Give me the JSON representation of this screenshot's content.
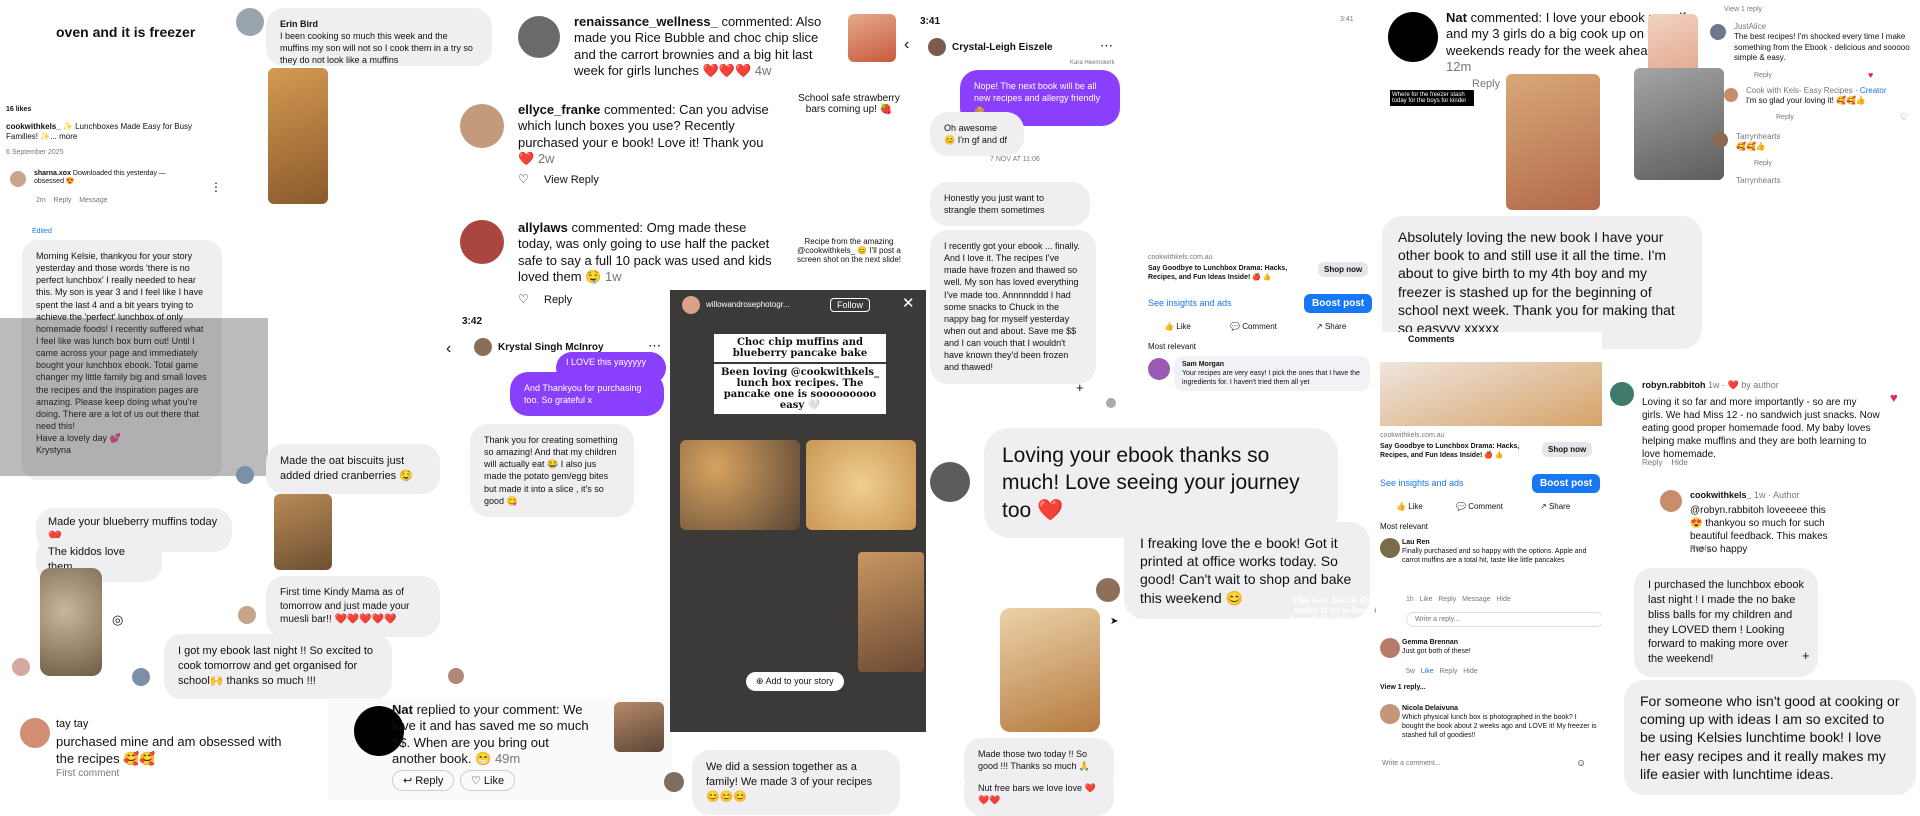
{
  "col1": {
    "overlay_text": "oven and it is freezer",
    "likes": "16 likes",
    "caption_user": "cookwithkels_",
    "caption_text": "✨ Lunchboxes Made Easy for Busy Families! ✨... more",
    "date": "6 September 2025",
    "sharna_user": "sharna.xox",
    "sharna_text": "Downloaded this yesterday — obsessed 😍",
    "sharna_meta": [
      "2m",
      "Reply",
      "Message"
    ],
    "edited": "Edited",
    "krystyna_msg": "Morning Kelsie, thankyou for your story yesterday and those words 'there is no perfect lunchbox' I really needed to hear this. My son is year 3 and I feel like I have spent the last 4 and a bit years trying to achieve the 'perfect' lunchbox of only homemade foods! I recently suffered what I feel like was lunch box burn out! Until I came across your page and immediately bought your lunchbox ebook. Total game changer my little family big and small loves the recipes and the inspiration pages are amazing. Please keep doing what you're doing. There are a lot of us out there that need this!",
    "krystyna_sign": "Have a lovely day 💕",
    "krystyna_name": "Krystyna",
    "blueberry_msg": "Made your blueberry muffins today ❤️",
    "kiddos_msg": "The kiddos love them.",
    "taytay_name": "tay tay",
    "taytay_msg": "purchased mine and am obsessed with the recipes 🥰🥰",
    "taytay_sub": "First comment"
  },
  "col2": {
    "erin_name": "Erin Bird",
    "erin_msg": "I been cooking so much this week and the muffins my son will not so I cook them in a try so they do not look like a muffins",
    "oat_msg": "Made the oat biscuits just added dried cranberries 🤤",
    "kindy_msg": "First time Kindy Mama as of tomorrow and just made your muesli bar!! ❤️❤️❤️❤️❤️",
    "ebook_msg": "I got my ebook last night !! So excited to cook tomorrow and get organised for school🙌 thanks so much !!!"
  },
  "col3": {
    "c1_user": "renaissance_wellness_",
    "c1_text": "commented: Also made you Rice Bubble and choc chip slice and the carrort brownies and a big hit last week for girls lunches ❤️❤️❤️",
    "c1_time": "4w",
    "c2_user": "ellyce_franke",
    "c2_text": "commented: Can you advise which lunch boxes you use? Recently purchased your e book! Love it! Thank you ❤️",
    "c2_time": "2w",
    "view_reply": "View Reply",
    "c3_user": "allylaws",
    "c3_text": "commented: Omg made these today, was only going to use half the packet safe to say a full 10 pack was used and kids loved them 🤤",
    "c3_time": "1w",
    "reply": "Reply",
    "time": "3:42",
    "chat_name": "Krystal Singh McInroy",
    "chat_top": "I LOVE this yayyyyy xxx",
    "chat_thanks": "And Thankyou for purchasing too. So grateful x",
    "chat_msg": "Thank you for creating something so amazing! And that my children will actually eat 😂 I also jus made the potato gem/egg bites but made it into a slice , it's so good 😋",
    "nat_name": "Nat",
    "nat_msg": "replied to your comment: We love it and has saved me so much $$. When are you bring out another book. 😁",
    "nat_time": "49m",
    "like": "Like"
  },
  "col4": {
    "story_top": "School safe strawberry bars coming up! 🍓",
    "story_bottom": "Recipe from the amazing @cookwithkels_ 😊 I'll post a screen shot on the next slide!",
    "choc_title": "Choc chip muffins and blueberry pancake bake",
    "choc_body": "Been loving @cookwithkels_ lunch box recipes. The pancake one is sooooooooo easy 🤍",
    "add_story": "Add to your story",
    "story_user": "willowandrosephotogr...",
    "follow": "Follow",
    "session_msg": "We did a session together as a family! We made 3 of your recipes 😊😊😊"
  },
  "col5": {
    "time": "3:41",
    "name": "Crystal-Leigh Eiszele",
    "sender_label": "Kara Heemskerk",
    "purple_msg": "Nope! The next book will be all new recipes and allergy friendly 🙈",
    "awesome_msg": "Oh awesome 😊 I'm gf and df",
    "date_sep": "7 NOV AT 11:06",
    "honest_msg": "Honestly you just want to strangle them sometimes",
    "ebook_msg": "I recently got your ebook ... finally. And I love it. The recipes I've made have frozen and thawed so well. My son has loved everything I've made too. Annnnnddd I had some snacks to Chuck in the nappy bag for myself yesterday when out and about. Save me $$ and I can vouch that I wouldn't have known they'd been frozen and thawed!",
    "loving_msg": "Loving your ebook thanks so much! Love seeing your journey too ❤️",
    "freaking_msg": "I freaking love the e book! Got it printed at office works today. So good! Can't wait to shop and bake this weekend 😊",
    "two_today": "Made those two today !! So good !!! Thanks so much 🙏🙏🙏",
    "nutfree": "Nut free bars we love love ❤️❤️❤️"
  },
  "col6": {
    "domain": "cookwithkels.com.au",
    "ad_title": "Say Goodbye to Lunchbox Drama: Hacks, Recipes, and Fun Ideas Inside! 🍎 👍",
    "shop_now": "Shop now",
    "insights": "See insights and ads",
    "boost": "Boost post",
    "like": "Like",
    "comment": "Comment",
    "share": "Share",
    "most_relevant": "Most relevant",
    "sam_name": "Sam Morgan",
    "sam_text": "Your recipes are very easy! I pick the ones that I have the ingredients for. I haven't tried them all yet",
    "last_batch": "The last batch didn't make it to school 😂 hopefully this will get a few days before I need to make more. Thank goodness they are quick and easy",
    "status_time": "3:41"
  },
  "col7": {
    "nat_name": "Nat",
    "nat_text": "commented: I love your ebook myself and my 3 girls do a big cook up on the weekends ready for the week ahead xx",
    "nat_time": "12m",
    "reply": "Reply",
    "absolutely_msg": "Absolutely loving the new book I have your other book to and still use it all the time. I'm about to give birth to my 4th boy and my freezer is stashed up for the beginning of school next week. Thank you for making that so easyyy xxxxx",
    "comments_hdr": "Comments",
    "domain": "cookwithkels.com.au",
    "ad_title": "Say Goodbye to Lunchbox Drama: Hacks, Recipes, and Fun Ideas Inside! 🍎 👍",
    "shop_now": "Shop now",
    "insights": "See insights and ads",
    "boost": "Boost post",
    "like": "Like",
    "comment": "Comment",
    "share": "Share",
    "most_relevant": "Most relevant",
    "lau_name": "Lau Ren",
    "lau_text": "Finally purchased and so happy with the options. Apple and carrot muffins are a total hit, taste like little pancakes",
    "lau_meta": [
      "1h",
      "Like",
      "Reply",
      "Message",
      "Hide"
    ],
    "write_reply": "Write a reply...",
    "gemma_name": "Gemma Brennan",
    "gemma_text": "Just got both of these!",
    "gemma_meta": [
      "5w",
      "Like",
      "Reply",
      "Hide"
    ],
    "view_reply": "View 1 reply...",
    "nicola_name": "Nicola Delaivuna",
    "nicola_text": "Which physical lunch box is photographed in the book? I bought the book about 2 weeks ago and LOVE it! My freezer is stashed full of goodies!!",
    "write_comment": "Write a comment...",
    "freezer_tag": "Where for the freezer stash today for the boys for kinder"
  },
  "col8": {
    "view_reply": "View 1 reply",
    "justalice": "JustAlice",
    "justalice_text": "The best recipes! I'm shocked every time I make something from the Ebook - delicious and sooooo simple & easy.",
    "reply": "Reply",
    "cwk_name": "Cook with Kels- Easy Recipes",
    "creator": "· Creator",
    "cwk_text": "I'm so glad your loving it! 🥰🥰👍",
    "tarryn": "Tarrynhearts",
    "tarryn_text": "🥰🥰👍",
    "tarryn2": "Tarrynhearts",
    "robyn_name": "robyn.rabbitoh",
    "robyn_meta": "1w · ❤️ by author",
    "robyn_text": "Loving it so far and more importantly - so are my girls. We had Miss 12 - no sandwich just snacks. Now eating good proper homemade food. My baby loves helping make muffins and they are both learning to love homemade.",
    "hide": "Hide",
    "cwk2_name": "cookwithkels_",
    "cwk2_meta": "1w · Author",
    "cwk2_text": "@robyn.rabbitoh loveeeee this 😍 thankyou so much for such beautiful feedback. This makes me so happy",
    "purchased_msg": "I purchased the lunchbox ebook last night ! I made the no bake bliss balls for my children and they LOVED them ! Looking forward to making more over the weekend!",
    "someone_msg": "For someone who isn't good at cooking or coming up with ideas I am so excited to be using Kelsies lunchtime book! I love her easy recipes and it really makes my life easier with lunchtime ideas."
  }
}
